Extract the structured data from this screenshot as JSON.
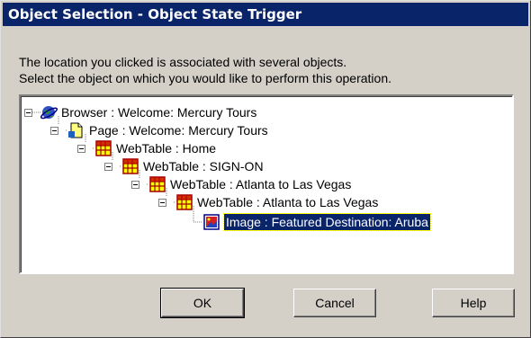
{
  "window": {
    "title": "Object Selection - Object State Trigger"
  },
  "description": {
    "line1": "The location you clicked is associated with several objects.",
    "line2": "Select the object on which you would like to perform this operation."
  },
  "tree": {
    "nodes": [
      {
        "label": "Browser : Welcome: Mercury Tours",
        "icon": "browser-globe-icon"
      },
      {
        "label": "Page : Welcome: Mercury Tours",
        "icon": "page-icon"
      },
      {
        "label": "WebTable : Home",
        "icon": "webtable-icon"
      },
      {
        "label": "WebTable : SIGN-ON",
        "icon": "webtable-icon"
      },
      {
        "label": "WebTable : Atlanta to Las Vegas",
        "icon": "webtable-icon"
      },
      {
        "label": "WebTable : Atlanta to Las Vegas",
        "icon": "webtable-icon"
      },
      {
        "label": "Image : Featured Destination: Aruba",
        "icon": "image-icon",
        "selected": true
      }
    ]
  },
  "buttons": {
    "ok": "OK",
    "cancel": "Cancel",
    "help": "Help"
  },
  "colors": {
    "titlebar": "#0a246a",
    "selection": "#0a246a",
    "face": "#d4d0c8"
  }
}
